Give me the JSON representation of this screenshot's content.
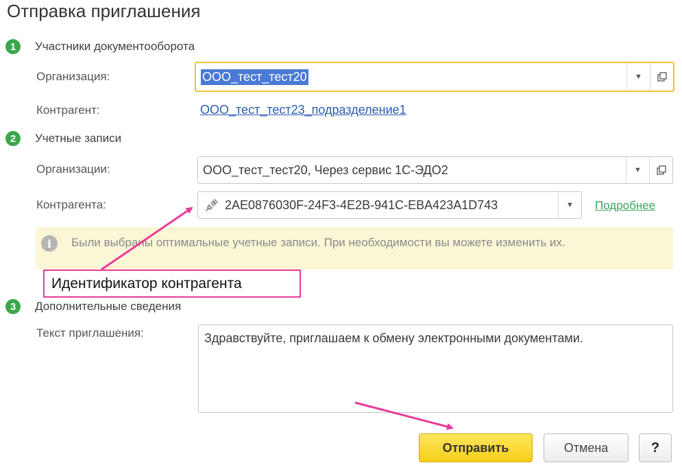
{
  "dialog": {
    "title": "Отправка приглашения"
  },
  "steps": [
    {
      "num": "1",
      "label": "Участники документооборота"
    },
    {
      "num": "2",
      "label": "Учетные записи"
    },
    {
      "num": "3",
      "label": "Дополнительные сведения"
    }
  ],
  "participants": {
    "organization_label": "Организация:",
    "organization_value": "ООО_тест_тест20",
    "counterparty_label": "Контрагент:",
    "counterparty_value": "ООО_тест_тест23_подразделение1"
  },
  "accounts": {
    "organizations_label": "Организации:",
    "organizations_value": "ООО_тест_тест20, Через сервис 1С-ЭДО2",
    "counterparty_label": "Контрагента:",
    "counterparty_value": "2AE0876030F-24F3-4E2B-941C-EBA423A1D743",
    "details_link": "Подробнее"
  },
  "info": {
    "text": "Были выбраны оптимальные учетные записи. При необходимости вы можете изменить их."
  },
  "annotation": {
    "callout_text": "Идентификатор контрагента",
    "accent_color": "#ea3a9a"
  },
  "additional": {
    "message_label": "Текст приглашения:",
    "message_value": "Здравствуйте, приглашаем к обмену электронными документами."
  },
  "buttons": {
    "send": "Отправить",
    "cancel": "Отмена",
    "help": "?"
  },
  "icons": {
    "dropdown": "chevron-down-icon",
    "open": "open-form-icon",
    "plug": "plug-icon",
    "info": "info-icon"
  }
}
